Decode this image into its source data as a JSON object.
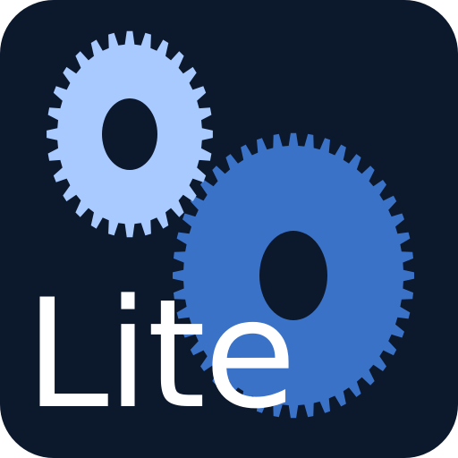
{
  "icon": {
    "label": "Lite",
    "colors": {
      "background": "#0c182c",
      "small_gear": "#a9caff",
      "large_gear": "#3a72c8",
      "gear_hole": "#0c182c",
      "label": "#ffffff"
    },
    "icons": [
      "small-gear-icon",
      "large-gear-icon"
    ]
  }
}
